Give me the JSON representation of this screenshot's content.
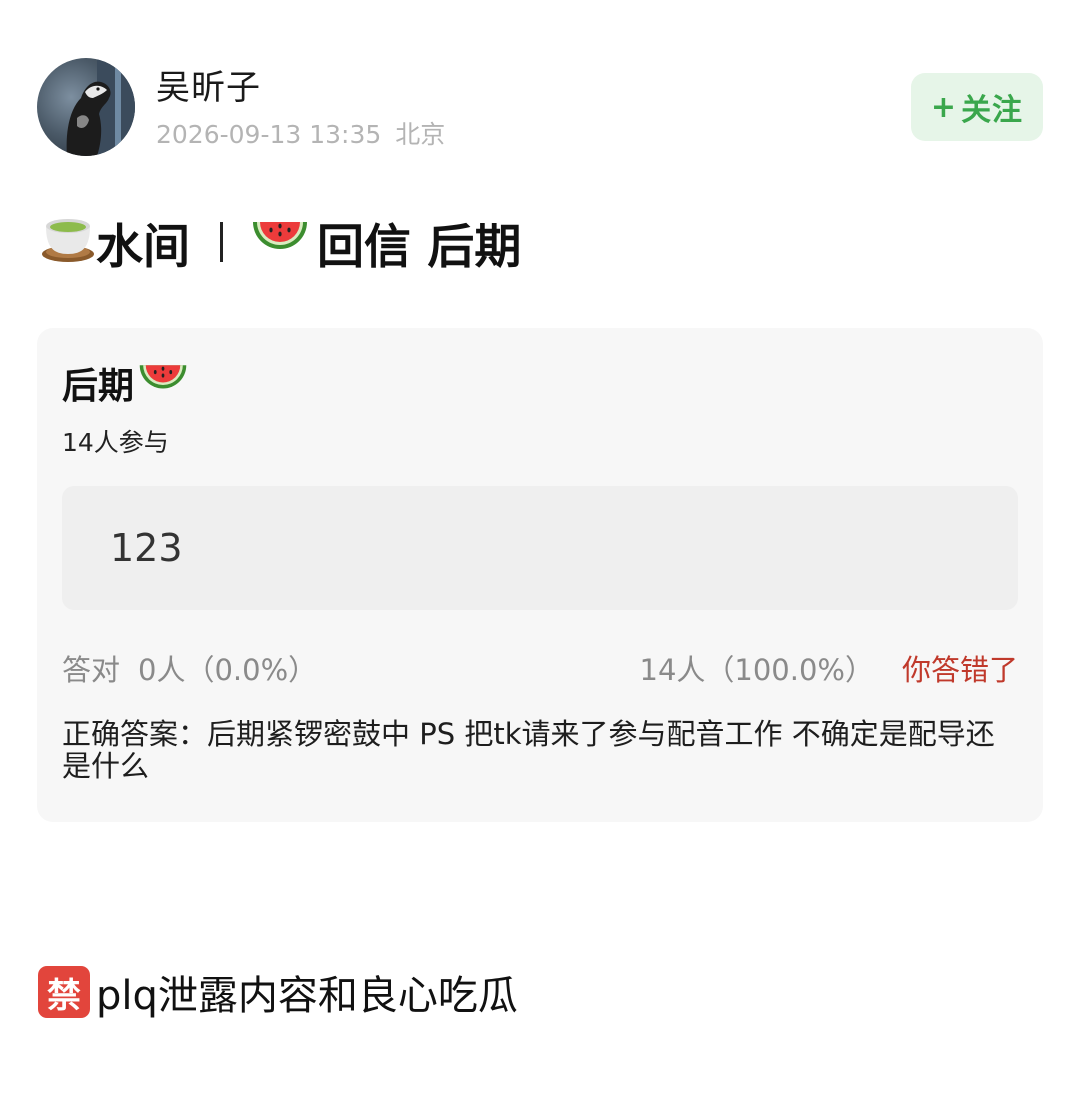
{
  "header": {
    "author_name": "吴昕子",
    "timestamp": "2026-09-13 13:35",
    "location": "北京",
    "follow_plus": "+",
    "follow_label": "关注"
  },
  "post_title": {
    "part1_emoji": "🍵",
    "part1_text": "水间",
    "part2_emoji": "🍉",
    "part2_text": "回信 后期"
  },
  "quiz": {
    "title": "后期",
    "title_emoji": "🍉",
    "participants": "14人参与",
    "option_text": "123",
    "correct_label": "答对",
    "correct_count": "0人（0.0%）",
    "wrong_count": "14人（100.0%）",
    "wrong_status": "你答错了",
    "answer_text": "正确答案：后期紧锣密鼓中 PS 把tk请来了参与配音工作 不确定是配导还是什么"
  },
  "footer": {
    "badge": "禁",
    "text": "plq泄露内容和良心吃瓜"
  },
  "colors": {
    "follow_bg": "#e6f5e8",
    "follow_text": "#3aa74c",
    "wrong_status": "#c0392b",
    "ban_badge": "#e2453c",
    "card_bg": "#f7f7f7"
  },
  "icons": {
    "avatar": "opossum-photo-avatar",
    "tea": "tea-cup-icon",
    "watermelon": "watermelon-icon",
    "ban": "prohibited-badge-icon"
  }
}
